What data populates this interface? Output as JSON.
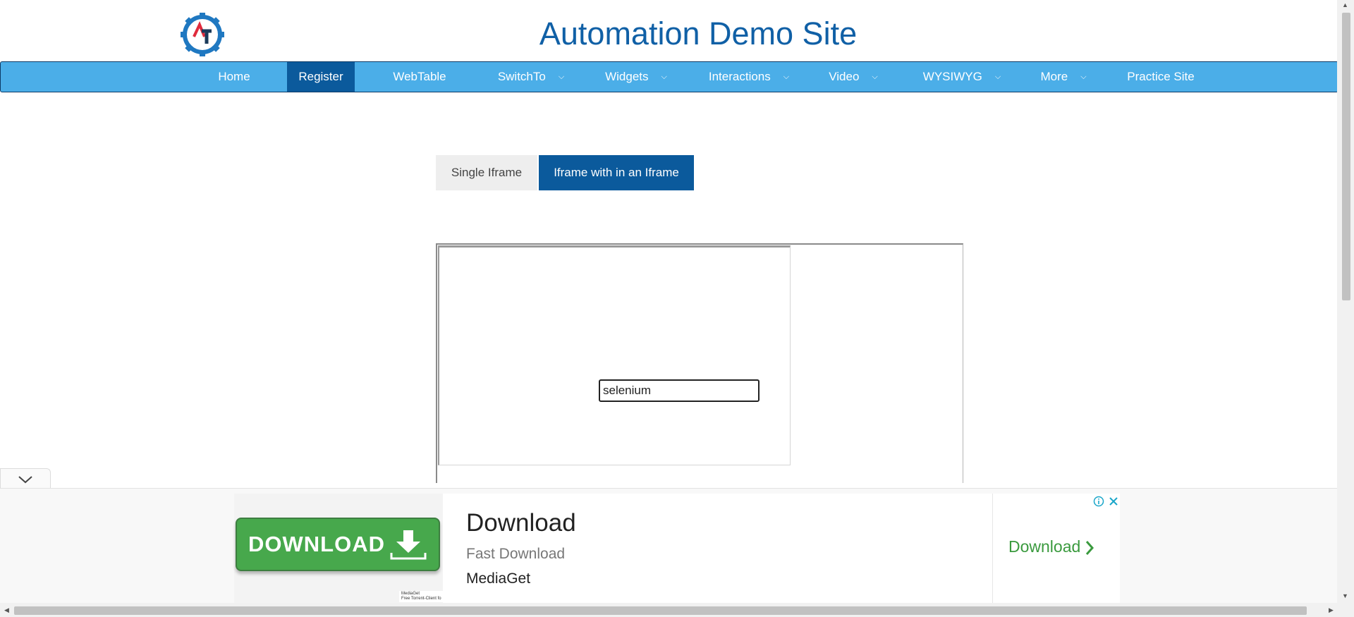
{
  "header": {
    "title": "Automation Demo Site",
    "logo_letters": "AT"
  },
  "nav": {
    "items": [
      {
        "label": "Home",
        "dropdown": false
      },
      {
        "label": "Register",
        "dropdown": false,
        "active": true
      },
      {
        "label": "WebTable",
        "dropdown": false
      },
      {
        "label": "SwitchTo",
        "dropdown": true
      },
      {
        "label": "Widgets",
        "dropdown": true
      },
      {
        "label": "Interactions",
        "dropdown": true
      },
      {
        "label": "Video",
        "dropdown": true
      },
      {
        "label": "WYSIWYG",
        "dropdown": true
      },
      {
        "label": "More",
        "dropdown": true
      },
      {
        "label": "Practice Site",
        "dropdown": false
      }
    ]
  },
  "tabs": {
    "single": "Single Iframe",
    "nested": "Iframe with in an Iframe",
    "active": "nested"
  },
  "iframe": {
    "input_value": "selenium"
  },
  "ad": {
    "button_text": "DOWNLOAD",
    "headline": "Download",
    "subtitle": "Fast Download",
    "brand": "MediaGet",
    "cta": "Download",
    "fine_print_1": "MediaGet",
    "fine_print_2": "Free Torrent-Client fo"
  },
  "colors": {
    "brand_blue": "#1060a6",
    "nav_bg": "#4baee8",
    "nav_active": "#0b5a9c",
    "ad_green": "#47a84c"
  }
}
